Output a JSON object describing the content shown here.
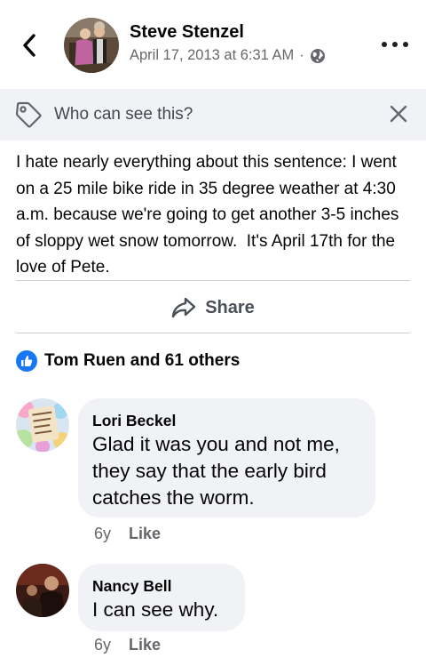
{
  "post": {
    "author": "Steve Stenzel",
    "timestamp": "April 17, 2013 at 6:31 AM",
    "separator": "·",
    "privacy_icon": "globe-icon",
    "text": "I hate nearly everything about this sentence: I went on a 25 mile bike ride in 35 degree weather at 4:30 a.m. because we're going to get another 3-5 inches of sloppy wet snow tomorrow.  It's April 17th for the love of Pete."
  },
  "audience": {
    "label": "Who can see this?"
  },
  "actions": {
    "share_label": "Share"
  },
  "reactions": {
    "summary": "Tom Ruen and 61 others"
  },
  "comments": [
    {
      "name": "Lori Beckel",
      "text": "Glad it was you and not me,\nthey say that the early bird\ncatches the worm.",
      "age": "6y",
      "like_label": "Like",
      "avatar_text": "May the ... of Easter be very ... upon you..."
    },
    {
      "name": "Nancy Bell",
      "text": "I can see why.",
      "age": "6y",
      "like_label": "Like"
    }
  ],
  "colors": {
    "accent": "#1877f2",
    "secondary_text": "#65676b",
    "bubble_bg": "#f0f2f5"
  }
}
